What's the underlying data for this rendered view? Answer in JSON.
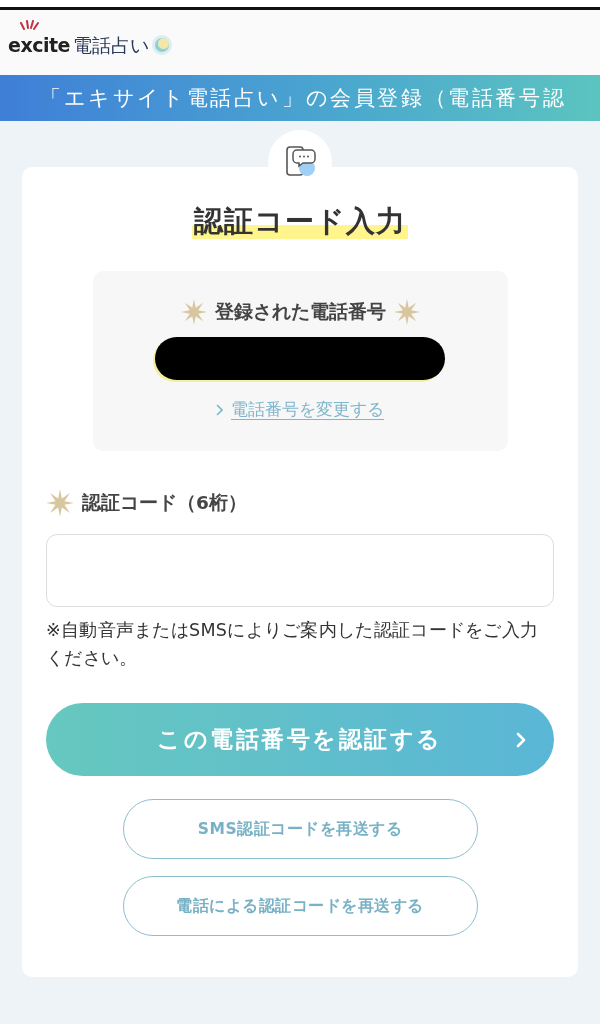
{
  "header": {
    "logo_brand": "excite",
    "logo_service": "電話占い"
  },
  "banner": {
    "title": "「エキサイト電話占い」の会員登録（電話番号認"
  },
  "card": {
    "title": "認証コード入力",
    "registered_phone": {
      "label": "登録された電話番号",
      "number_redacted": true,
      "change_link": "電話番号を変更する"
    },
    "code_field": {
      "label": "認証コード（6桁）"
    },
    "note": "※自動音声またはSMSによりご案内した認証コードをご入力ください。",
    "primary_button": {
      "label": "この電話番号を認証する"
    },
    "secondary_buttons": [
      "SMS認証コードを再送する",
      "電話による認証コードを再送する"
    ]
  }
}
